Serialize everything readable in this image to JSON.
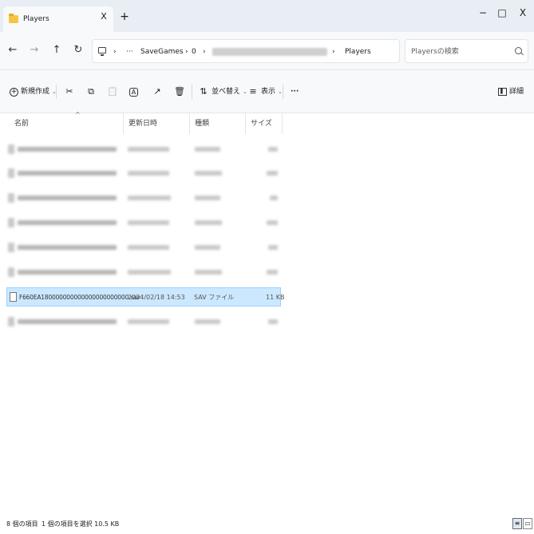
{
  "window": {
    "tab_title": "Players",
    "tab_close": "X",
    "new_tab": "+",
    "minimize": "−",
    "maximize": "□",
    "close": "X"
  },
  "nav": {
    "back": "←",
    "forward": "→",
    "up": "↑",
    "refresh": "↻",
    "sep": "›",
    "more": "···",
    "crumbs": [
      "SaveGames",
      "0",
      "Players"
    ],
    "search_placeholder": "Playersの検索"
  },
  "toolbar": {
    "new_label": "新規作成",
    "cut_icon": "✂",
    "copy_icon": "⧉",
    "paste_icon": "📋",
    "rename_icon": "A",
    "share_icon": "↗",
    "delete_icon": "🗑",
    "sort_label": "並べ替え",
    "view_label": "表示",
    "more_label": "···",
    "details_label": "詳細"
  },
  "columns": [
    "名前",
    "更新日時",
    "種類",
    "サイズ"
  ],
  "selected_file": {
    "name": "F660EA180000000000000000000000.sav",
    "modified": "2024/02/18 14:53",
    "type": "SAV ファイル",
    "size": "11 KB"
  },
  "status": {
    "item_count": "8 個の項目",
    "selection": "1 個の項目を選択  10.5 KB"
  }
}
